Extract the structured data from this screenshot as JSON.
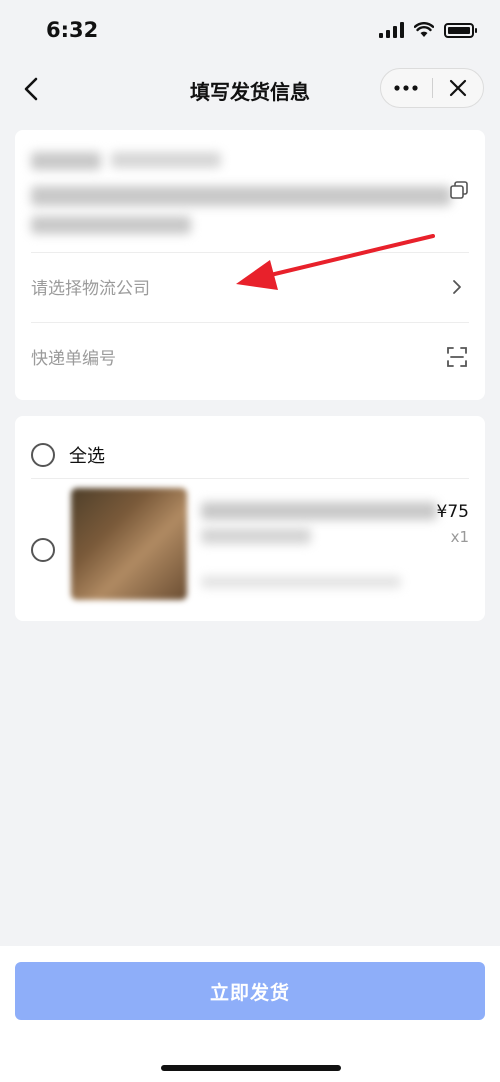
{
  "status_bar": {
    "time": "6:32"
  },
  "nav": {
    "title": "填写发货信息",
    "back_icon": "chevron-left-icon",
    "more_icon": "more-dots-icon",
    "close_icon": "close-icon"
  },
  "shipping": {
    "logistics_placeholder": "请选择物流公司",
    "tracking_placeholder": "快递单编号",
    "copy_icon": "copy-icon",
    "chevron_icon": "chevron-right-icon",
    "scan_icon": "scan-icon"
  },
  "items": {
    "select_all_label": "全选",
    "products": [
      {
        "price": "¥75",
        "qty": "x1"
      }
    ]
  },
  "footer": {
    "submit_label": "立即发货"
  },
  "colors": {
    "background": "#f2f3f5",
    "button": "#8eaef9",
    "annotation_arrow": "#e8212b"
  }
}
